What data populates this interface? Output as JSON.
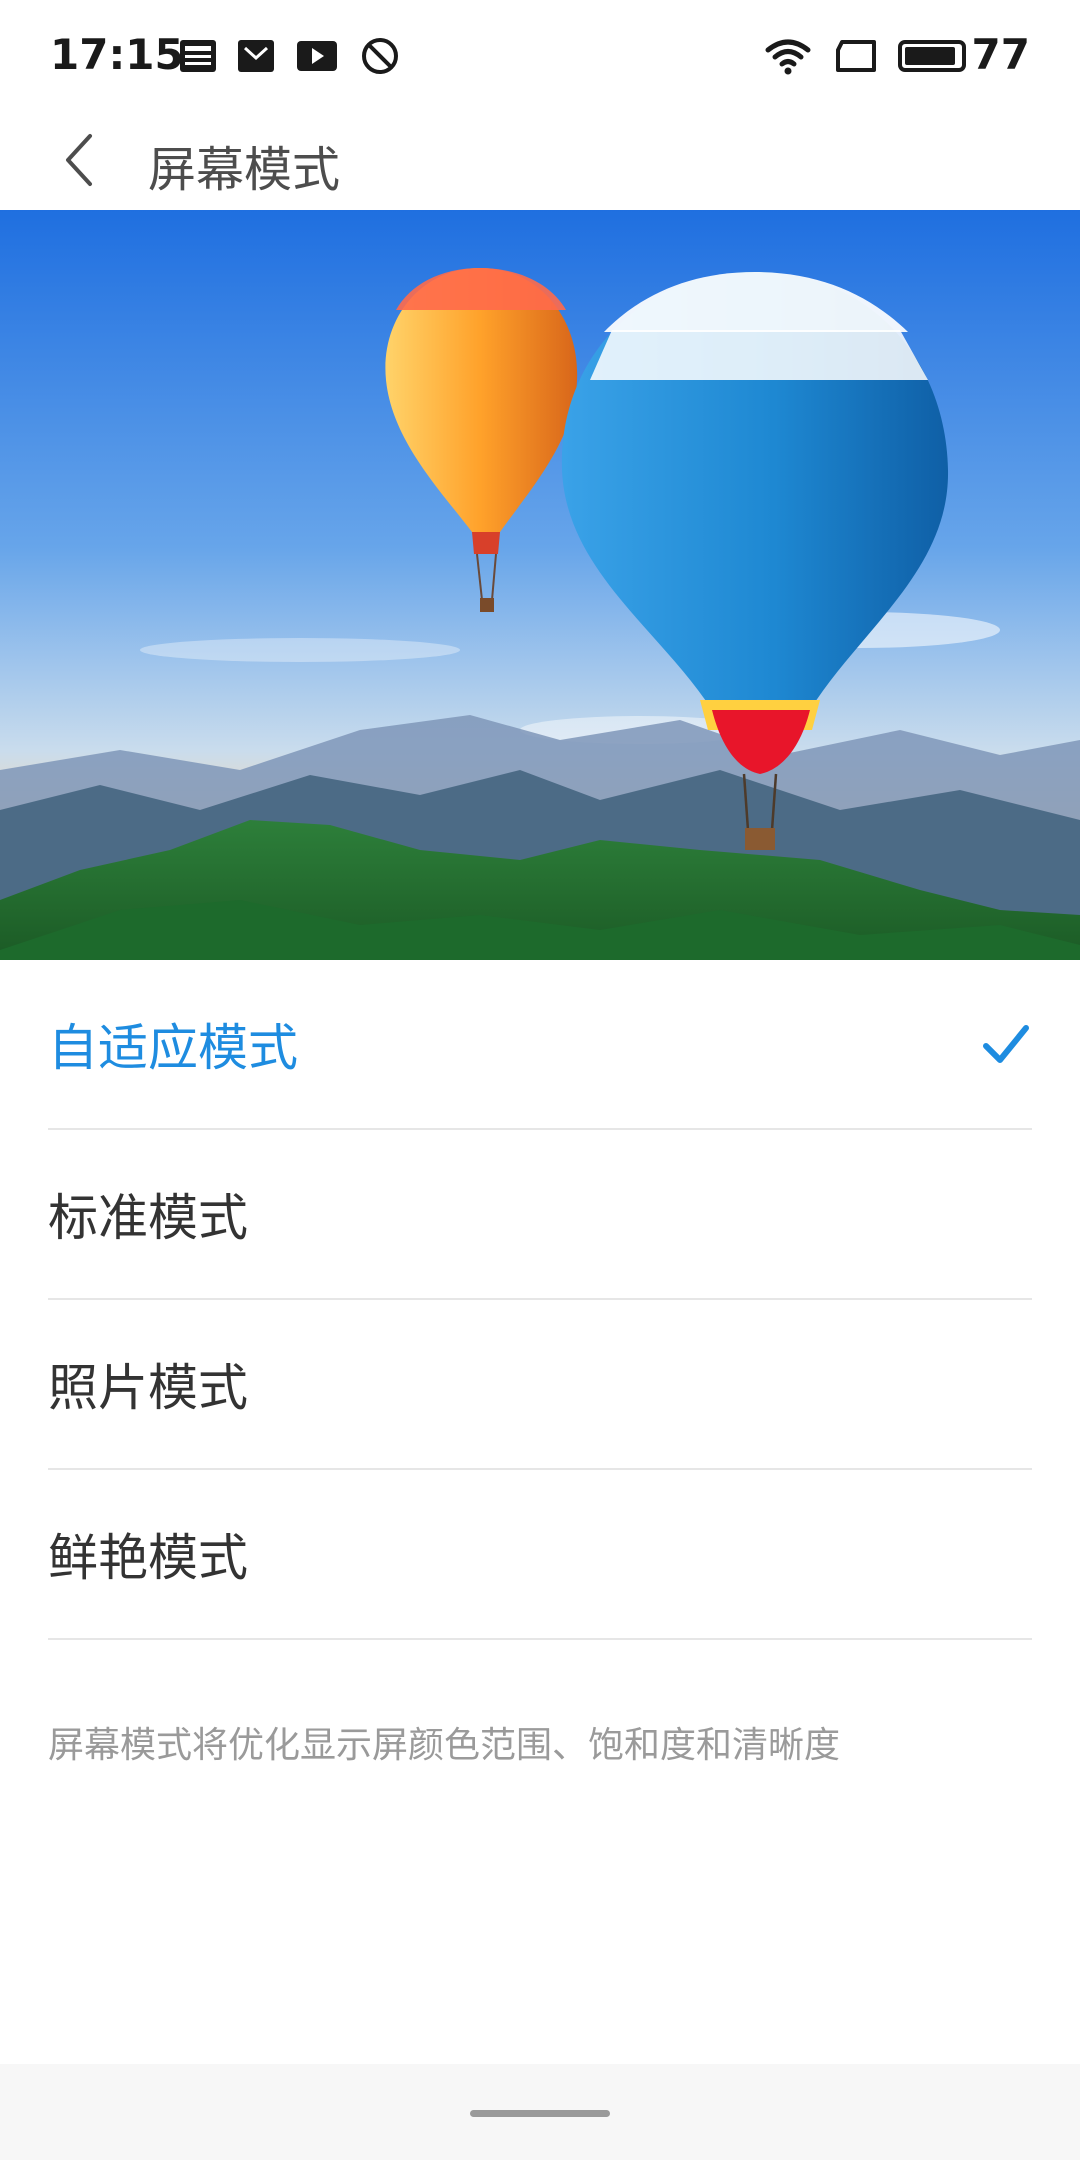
{
  "status_bar": {
    "time": "17:15",
    "battery_level": "77",
    "icons": [
      "news-icon",
      "mail-icon",
      "youtube-icon",
      "do-not-disturb-icon",
      "wifi-icon",
      "screen-cast-icon",
      "battery-icon"
    ]
  },
  "header": {
    "title": "屏幕模式",
    "back_icon": "chevron-left-icon"
  },
  "modes": [
    {
      "label": "自适应模式",
      "selected": true
    },
    {
      "label": "标准模式",
      "selected": false
    },
    {
      "label": "照片模式",
      "selected": false
    },
    {
      "label": "鲜艳模式",
      "selected": false
    }
  ],
  "description": "屏幕模式将优化显示屏颜色范围、饱和度和清晰度",
  "colors": {
    "accent": "#1e8ce0",
    "text_primary": "#333333",
    "text_secondary": "#9a9a9a",
    "divider": "#e6e6e6"
  }
}
